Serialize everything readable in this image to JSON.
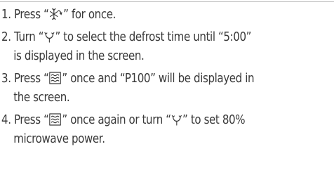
{
  "steps": [
    {
      "number": "1.",
      "pre": "Press “",
      "icon": "defrost-snowflake-icon",
      "post": "” for once."
    },
    {
      "number": "2.",
      "pre": "Turn “",
      "icon": "dial-knob-icon",
      "post": "” to select the defrost time until “5:00”",
      "line2": "is displayed in the screen."
    },
    {
      "number": "3.",
      "pre": "Press “",
      "icon": "microwave-power-icon",
      "post": "” once and “P100” will be displayed in",
      "line2": "the screen."
    },
    {
      "number": "4.",
      "pre": "Press “",
      "icon": "microwave-power-icon",
      "mid": "” once again or turn “",
      "icon2": "dial-knob-icon",
      "post": "” to set 80%",
      "line2": "microwave power."
    }
  ]
}
